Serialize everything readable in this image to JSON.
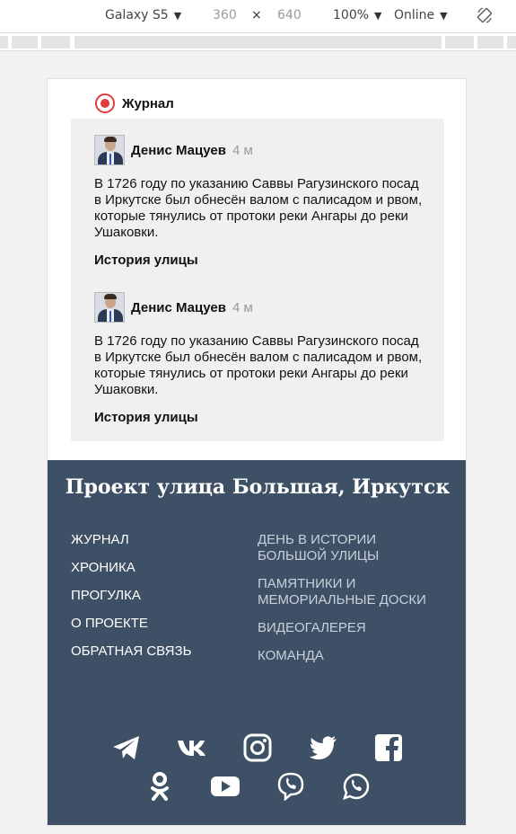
{
  "toolbar": {
    "device": "Galaxy S5",
    "width": "360",
    "times": "×",
    "height": "640",
    "zoom": "100%",
    "network": "Online"
  },
  "journal": {
    "section_title": "Журнал",
    "posts": [
      {
        "author": "Денис Мацуев",
        "time": "4 м",
        "text": "В 1726 году по указанию Саввы Рагузинского посад в Иркутске был обнесён валом с палисадом и рвом, которые тянулись от протоки реки Ангары до реки Ушаковки.",
        "tag": "История улицы"
      },
      {
        "author": "Денис Мацуев",
        "time": "4 м",
        "text": "В 1726 году по указанию Саввы Рагузинского посад в Иркутске был обнесён валом с палисадом и рвом, которые тянулись от протоки реки Ангары до реки Ушаковки.",
        "tag": "История улицы"
      }
    ]
  },
  "footer": {
    "title": "Проект улица Большая, Иркутск",
    "menu_left": [
      "ЖУРНАЛ",
      "ХРОНИКА",
      "ПРОГУЛКА",
      "О ПРОЕКТЕ",
      "ОБРАТНАЯ СВЯЗЬ"
    ],
    "menu_right": [
      "ДЕНЬ В ИСТОРИИ БОЛЬШОЙ УЛИЦЫ",
      "ПАМЯТНИКИ И МЕМОРИАЛЬНЫЕ ДОСКИ",
      "ВИДЕОГАЛЕРЕЯ",
      "КОМАНДА"
    ],
    "social_row1": [
      "telegram-icon",
      "vk-icon",
      "instagram-icon",
      "twitter-icon",
      "facebook-icon"
    ],
    "social_row2": [
      "odnoklassniki-icon",
      "youtube-icon",
      "viber-icon",
      "whatsapp-icon"
    ]
  },
  "colors": {
    "footer_bg": "#3e5065",
    "record_red": "#e23b3b",
    "feed_bg": "#f0f0f0"
  }
}
